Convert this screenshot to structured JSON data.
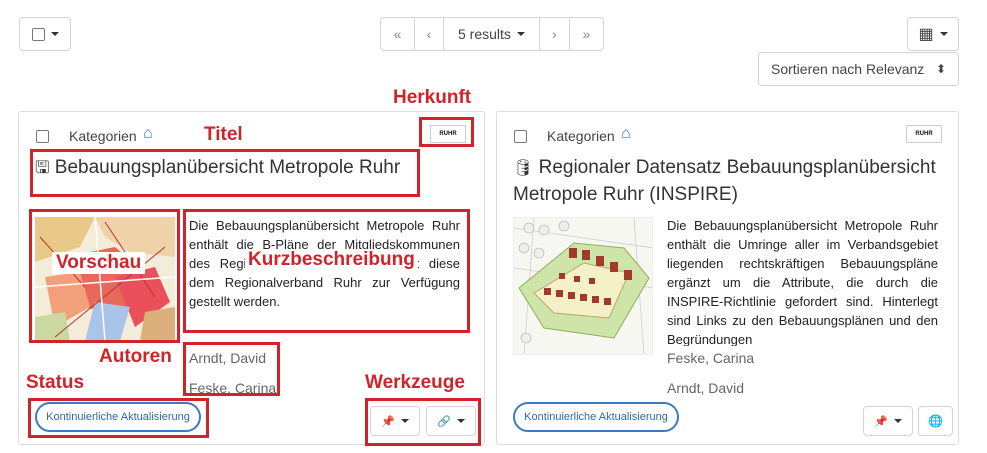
{
  "toolbar": {
    "results_label": "5 results",
    "first_glyph": "«",
    "prev_glyph": "‹",
    "next_glyph": "›",
    "last_glyph": "»",
    "sort_label": "Sortieren nach Relevanz",
    "sort_glyph": "⬍",
    "grid_glyph": "▦"
  },
  "cards": [
    {
      "category_label": "Kategorien",
      "home_glyph": "⌂",
      "title_icon": "🖫",
      "title": "Bebauungsplanübersicht Metropole Ruhr",
      "description": "Die Bebauungsplanübersicht Metropole Ruhr enthält die B-Pläne der Mitgliedskommunen des Regionalverbandes Ruhr, soweit diese dem Regionalverband Ruhr zur Verfügung gestellt werden.",
      "authors": [
        "Arndt, David",
        "Feske, Carina"
      ],
      "status": "Kontinuierliche Aktualisierung",
      "pin_glyph": "📌",
      "link_glyph": "🔗",
      "logo_text": "RUHR"
    },
    {
      "category_label": "Kategorien",
      "home_glyph": "⌂",
      "title_icon": "🛢",
      "title": "Regionaler Datensatz Bebauungsplanübersicht Metropole Ruhr (INSPIRE)",
      "description": "Die Bebauungsplanübersicht Metropole Ruhr enthält die Umringe aller im Verbandsgebiet liegenden rechtskräftigen Bebauungspläne ergänzt um die Attribute, die durch die INSPIRE-Richtlinie gefordert sind. Hinterlegt sind Links zu den Bebauungsplänen und den Begründungen",
      "authors": [
        "Feske, Carina",
        "Arndt, David"
      ],
      "status": "Kontinuierliche Aktualisierung",
      "pin_glyph": "📌",
      "globe_glyph": "🌐",
      "logo_text": "RUHR"
    }
  ],
  "annotations": {
    "herkunft": "Herkunft",
    "titel": "Titel",
    "vorschau": "Vorschau",
    "kurzbeschreibung": "Kurzbeschreibung",
    "autoren": "Autoren",
    "status": "Status",
    "werkzeuge": "Werkzeuge"
  },
  "colors": {
    "annotation_red": "#d0232a",
    "status_blue": "#3a7bbf",
    "home_blue": "#3a7bbf"
  }
}
